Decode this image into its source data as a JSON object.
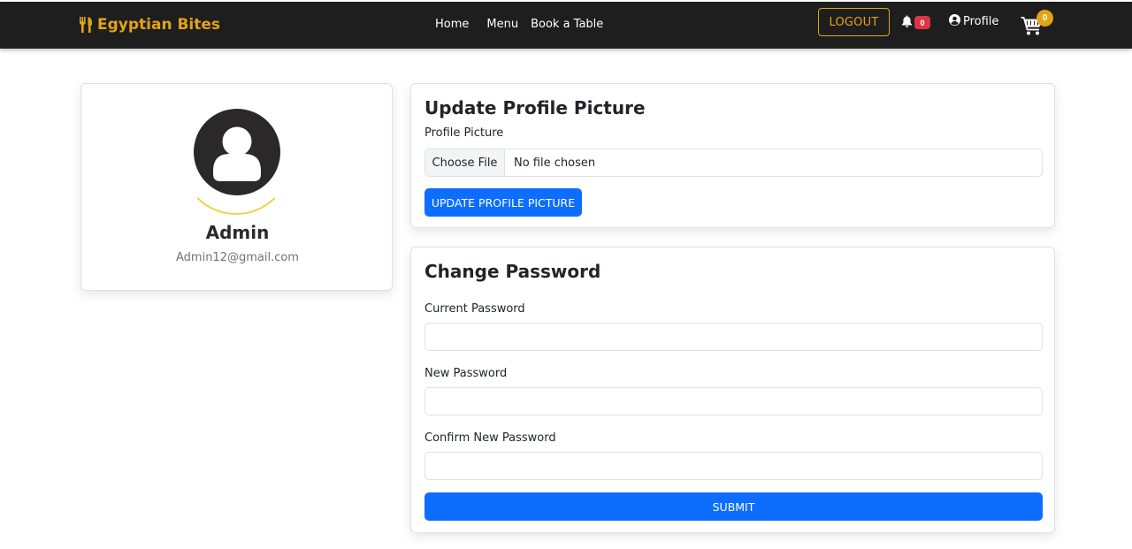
{
  "navbar": {
    "brand": "Egyptian Bites",
    "links": [
      "Home",
      "Menu",
      "Book a Table"
    ],
    "logout_label": "LOGOUT",
    "notification_count": "0",
    "profile_label": "Profile",
    "cart_count": "0"
  },
  "profile": {
    "name": "Admin",
    "email": "Admin12@gmail.com"
  },
  "picture_form": {
    "title": "Update Profile Picture",
    "field_label": "Profile Picture",
    "choose_label": "Choose File",
    "file_status": "No file chosen",
    "button_label": "UPDATE PROFILE PICTURE"
  },
  "password_form": {
    "title": "Change Password",
    "current_label": "Current Password",
    "current_value": "",
    "new_label": "New Password",
    "new_value": "",
    "confirm_label": "Confirm New Password",
    "confirm_value": "",
    "submit_label": "SUBMIT"
  },
  "colors": {
    "navbar_bg": "#1f1e1e",
    "brand_gold": "#e0a418",
    "primary": "#0d6efd",
    "danger": "#dc3545"
  },
  "icons": [
    "utensils-icon",
    "bell-icon",
    "user-circle-icon",
    "cart-icon",
    "avatar-user-icon"
  ]
}
